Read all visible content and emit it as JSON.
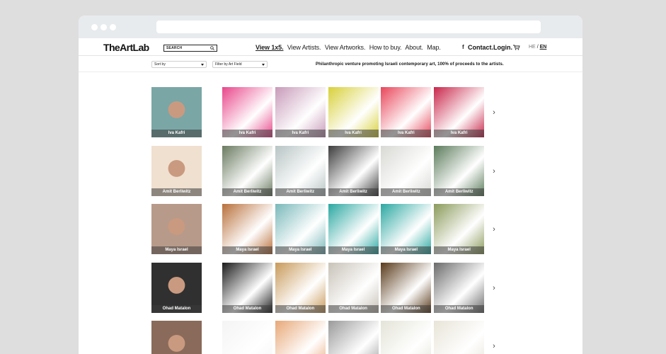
{
  "header": {
    "logo": "TheArtLab",
    "search_placeholder": "SEARCH",
    "nav": [
      {
        "label": "View 1x5.",
        "active": true
      },
      {
        "label": "View Artists.",
        "active": false
      },
      {
        "label": "View Artworks.",
        "active": false
      },
      {
        "label": "How to buy.",
        "active": false
      },
      {
        "label": "About.",
        "active": false
      },
      {
        "label": "Map.",
        "active": false
      }
    ],
    "facebook": "f",
    "contact": "Contact.",
    "login": "Login.",
    "lang_he": "HE",
    "lang_sep": "/",
    "lang_en": "EN"
  },
  "filters": {
    "sort_by": "Sort by",
    "filter_field": "Filter by Art Field",
    "tagline": "Philanthropic venture promoting Israeli contemporary art, 100% of proceeds to the artists."
  },
  "rows": [
    {
      "artist": "Iva Kafri",
      "artworks": [
        "Iva Kafri",
        "Iva Kafri",
        "Iva Kafri",
        "Iva Kafri",
        "Iva Kafri"
      ],
      "palette": [
        "#e8468a",
        "#c89ab9",
        "#d8d03a",
        "#e8465a",
        "#c8264a"
      ]
    },
    {
      "artist": "Amit Berliwitz",
      "artworks": [
        "Amit Berliwitz",
        "Amit Berliwitz",
        "Amit Berliwitz",
        "Amit Berliwitz",
        "Amit Berliwitz"
      ],
      "palette": [
        "#6a7a60",
        "#b8c4c4",
        "#3c3c3c",
        "#d8d8d4",
        "#5a7a5a"
      ]
    },
    {
      "artist": "Maya Israel",
      "artworks": [
        "Maya Israel",
        "Maya Israel",
        "Maya Israel",
        "Maya Israel",
        "Maya Israel"
      ],
      "palette": [
        "#b8703a",
        "#7ab8ba",
        "#2aa8a2",
        "#2aa8a2",
        "#8a9a5a"
      ]
    },
    {
      "artist": "Ohad Matalon",
      "artworks": [
        "Ohad Matalon",
        "Ohad Matalon",
        "Ohad Matalon",
        "Ohad Matalon",
        "Ohad Matalon"
      ],
      "palette": [
        "#1a1a1a",
        "#c89a5a",
        "#c8c2b8",
        "#5a3a1a",
        "#6a6a6a"
      ]
    },
    {
      "artist": "",
      "artworks": [
        "",
        "",
        "",
        "",
        ""
      ],
      "palette": [
        "#f4f4f4",
        "#e8a878",
        "#9a9a9a",
        "#e4e4d8",
        "#e8e4d8"
      ]
    }
  ],
  "portrait_colors": [
    "#7aa6a6",
    "#f0e0d0",
    "#b89a8a",
    "#303030",
    "#8a6a5a"
  ],
  "next_arrow": "›"
}
